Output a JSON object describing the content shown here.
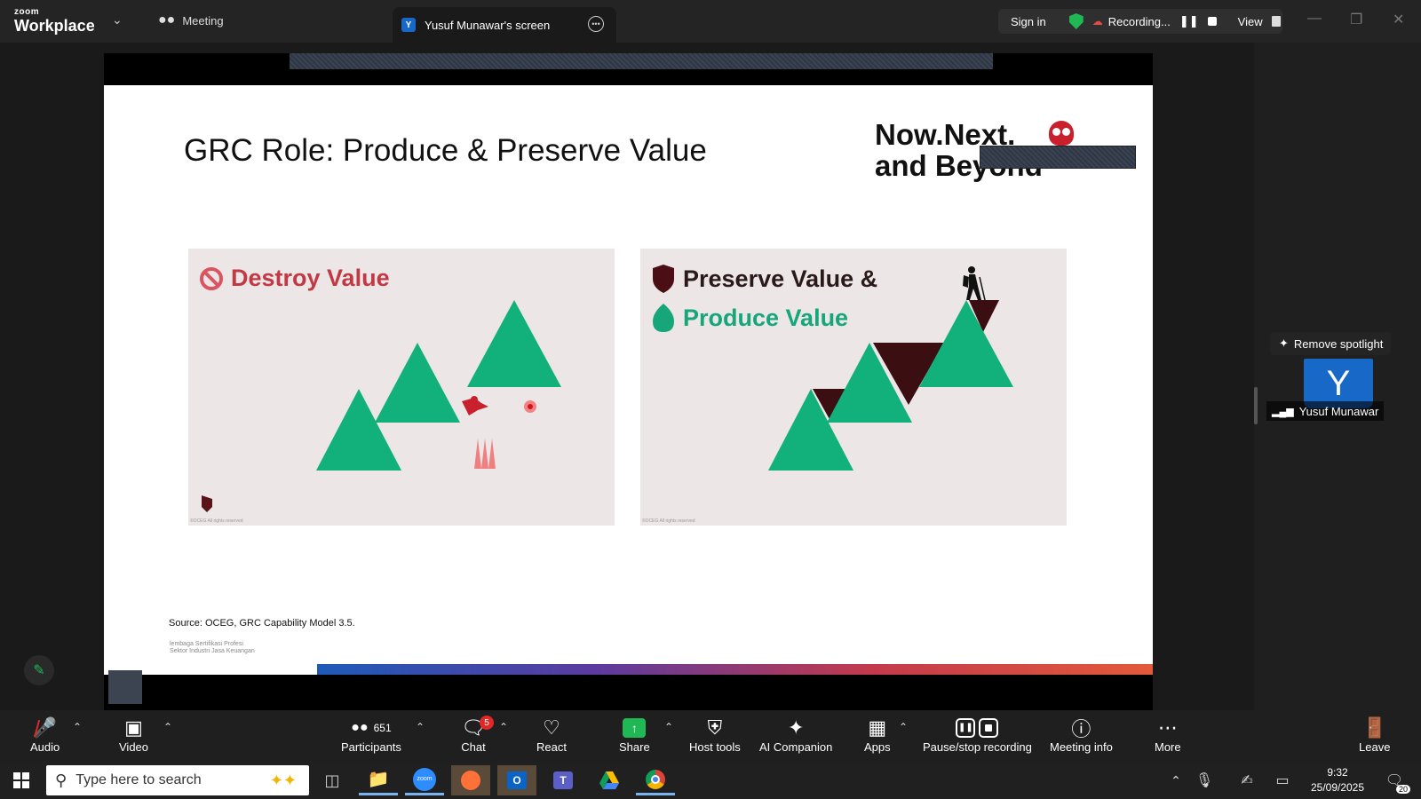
{
  "titlebar": {
    "brand_small": "zoom",
    "brand_large": "Workplace",
    "tab_meeting": "Meeting",
    "tab_screen": "Yusuf Munawar's screen",
    "tab_screen_avatar": "Y",
    "sign_in": "Sign in",
    "recording": "Recording...",
    "view": "View"
  },
  "slide": {
    "title": "GRC Role: Produce & Preserve Value",
    "logo_line1": "Now.Next.",
    "logo_line2": "and Beyond",
    "left_panel_heading": "Destroy Value",
    "right_panel_heading_1": "Preserve Value &",
    "right_panel_heading_2": "Produce Value",
    "panel_footnote": "©OCEG All rights reserved",
    "source": "Source: OCEG, GRC Capability Model 3.5.",
    "org_line1": "lembaga Sertifikasi Profesi",
    "org_line2": "Sektor Industri Jasa Keuangan"
  },
  "spotlight": {
    "remove_label": "Remove spotlight",
    "avatar_letter": "Y",
    "participant_name": "Yusuf Munawar"
  },
  "toolbar": {
    "audio": "Audio",
    "video": "Video",
    "participants": "Participants",
    "participants_count": "651",
    "chat": "Chat",
    "chat_badge": "5",
    "react": "React",
    "share": "Share",
    "host_tools": "Host tools",
    "ai_companion": "AI Companion",
    "apps": "Apps",
    "pause_stop": "Pause/stop recording",
    "meeting_info": "Meeting info",
    "more": "More",
    "leave": "Leave"
  },
  "taskbar": {
    "search_placeholder": "Type here to search",
    "time": "9:32",
    "date": "25/09/2025",
    "notification_count": "20"
  },
  "colors": {
    "accent_green": "#1fb855",
    "triangle_green": "#12b07a",
    "destroy_red": "#c03a46",
    "dark_maroon": "#3b0e12"
  }
}
